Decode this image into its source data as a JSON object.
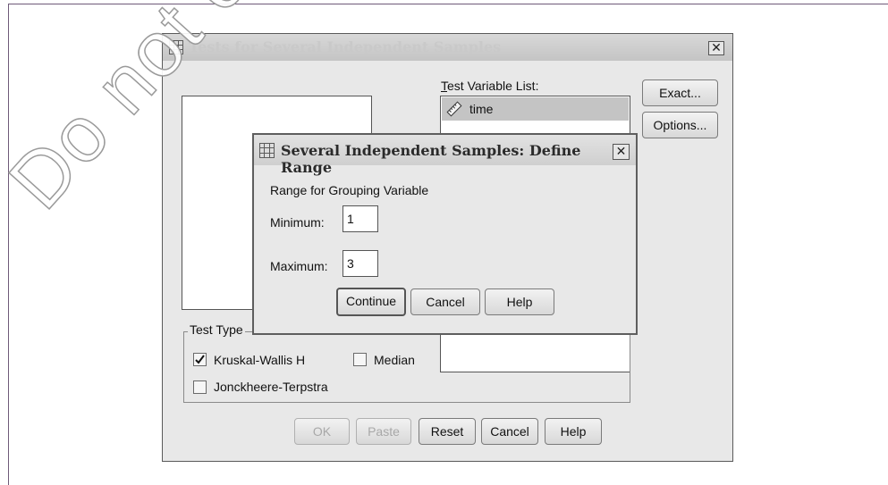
{
  "main_dialog": {
    "title": "Tests for Several Independent Samples",
    "test_variable_label": "Test Variable List:",
    "test_variables": [
      "time"
    ],
    "side_buttons": {
      "exact": "Exact...",
      "options": "Options..."
    },
    "test_type_label": "Test Type",
    "test_types": [
      {
        "label": "Kruskal-Wallis H",
        "checked": true
      },
      {
        "label": "Median",
        "checked": false
      },
      {
        "label": "Jonckheere-Terpstra",
        "checked": false
      }
    ],
    "bottom_buttons": {
      "ok": "OK",
      "paste": "Paste",
      "reset": "Reset",
      "cancel": "Cancel",
      "help": "Help"
    }
  },
  "range_dialog": {
    "title": "Several Independent Samples: Define Range",
    "group_label": "Range for Grouping Variable",
    "minimum_label": "Minimum:",
    "minimum_value": "1",
    "maximum_label": "Maximum:",
    "maximum_value": "3",
    "buttons": {
      "continue": "Continue",
      "cancel": "Cancel",
      "help": "Help"
    }
  },
  "watermark": "Do not copy"
}
